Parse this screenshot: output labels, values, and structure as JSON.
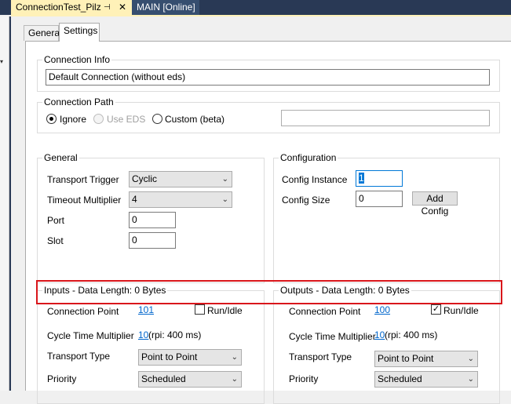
{
  "tabs": {
    "active": {
      "label": "ConnectionTest_Pilz",
      "pin_icon": "pin-icon",
      "close_icon": "✕"
    },
    "other": {
      "label": "MAIN [Online]"
    }
  },
  "subtabs": {
    "general": "General",
    "settings": "Settings"
  },
  "connection_info": {
    "title": "Connection Info",
    "value": "Default Connection (without eds)"
  },
  "connection_path": {
    "title": "Connection Path",
    "options": {
      "ignore": "Ignore",
      "use_eds": "Use EDS",
      "custom": "Custom (beta)"
    },
    "selected": "Ignore",
    "custom_value": ""
  },
  "general": {
    "title": "General",
    "transport_trigger_label": "Transport Trigger",
    "transport_trigger_value": "Cyclic",
    "timeout_multiplier_label": "Timeout Multiplier",
    "timeout_multiplier_value": "4",
    "port_label": "Port",
    "port_value": "0",
    "slot_label": "Slot",
    "slot_value": "0"
  },
  "configuration": {
    "title": "Configuration",
    "config_instance_label": "Config Instance",
    "config_instance_value": "1",
    "config_size_label": "Config Size",
    "config_size_value": "0",
    "add_config_label": "Add Config"
  },
  "inputs": {
    "title": "Inputs - Data Length: 0 Bytes",
    "connection_point_label": "Connection Point",
    "connection_point_value": "101",
    "run_idle_label": "Run/Idle",
    "run_idle_checked": false,
    "cycle_time_label": "Cycle Time Multiplier",
    "cycle_time_value": "10",
    "rpi_text": "(rpi: 400 ms)",
    "transport_type_label": "Transport Type",
    "transport_type_value": "Point to Point",
    "priority_label": "Priority",
    "priority_value": "Scheduled"
  },
  "outputs": {
    "title": "Outputs - Data Length: 0 Bytes",
    "connection_point_label": "Connection Point",
    "connection_point_value": "100",
    "run_idle_label": "Run/Idle",
    "run_idle_checked": true,
    "cycle_time_label": "Cycle Time Multiplier",
    "cycle_time_value": "10",
    "rpi_text": "(rpi: 400 ms)",
    "transport_type_label": "Transport Type",
    "transport_type_value": "Point to Point",
    "priority_label": "Priority",
    "priority_value": "Scheduled"
  },
  "colors": {
    "highlight": "#d9161b",
    "link": "#0066cc",
    "tab_active": "#fff1b8",
    "tabstrip": "#293955"
  }
}
